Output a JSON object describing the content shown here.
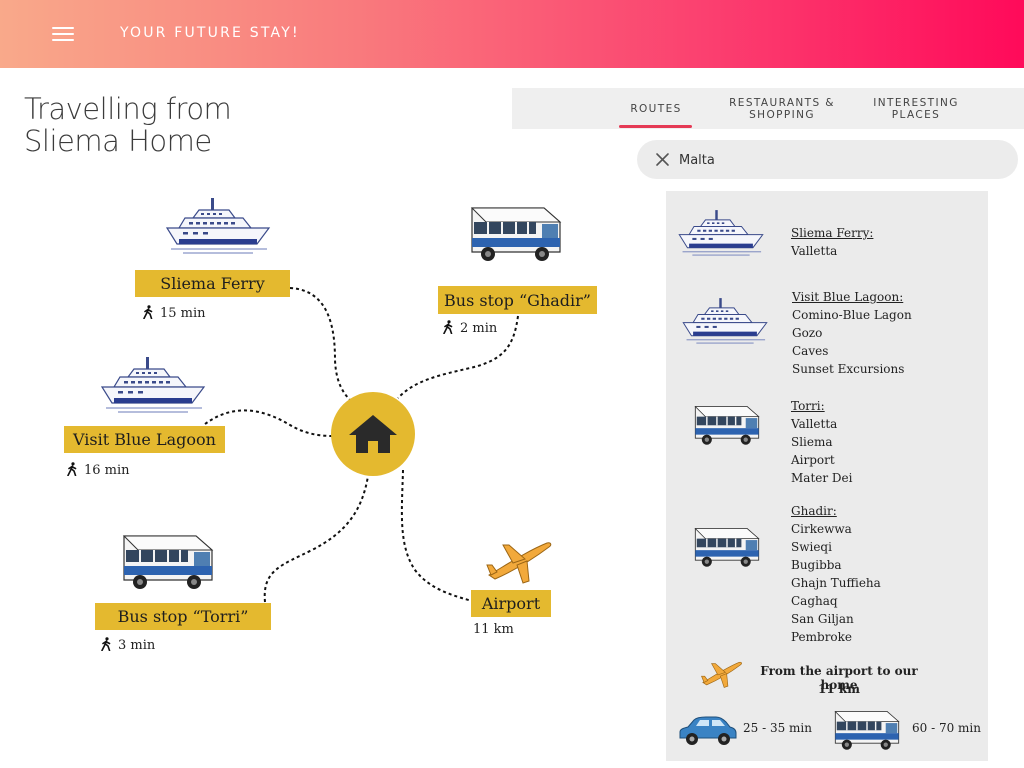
{
  "header": {
    "menu_icon": "hamburger-menu-icon",
    "brand": "YOUR FUTURE STAY!",
    "gradient": [
      "#f9a98a",
      "#ff0a5a"
    ]
  },
  "page": {
    "title_line1": "Travelling from",
    "title_line2": "Sliema Home"
  },
  "tabs": [
    {
      "label": "ROUTES",
      "active": true
    },
    {
      "label_line1": "RESTAURANTS &",
      "label_line2": "SHOPPING"
    },
    {
      "label_line1": "INTERESTING",
      "label_line2": "PLACES"
    }
  ],
  "search": {
    "value": "Malta",
    "clear_icon": "close-icon"
  },
  "map": {
    "center_icon": "home-icon",
    "accent": "#e4b92f",
    "places": [
      {
        "name": "Sliema Ferry",
        "icon": "ferry-icon",
        "distance": "15 min",
        "mode": "walk"
      },
      {
        "name": "Visit Blue Lagoon",
        "icon": "ferry-icon",
        "distance": "16 min",
        "mode": "walk"
      },
      {
        "name": "Bus stop “Torri”",
        "icon": "bus-icon",
        "distance": "3 min",
        "mode": "walk"
      },
      {
        "name": "Bus stop “Ghadir”",
        "icon": "bus-icon",
        "distance": "2 min",
        "mode": "walk"
      },
      {
        "name": "Airport",
        "icon": "airplane-icon",
        "distance": "11 km",
        "mode": ""
      }
    ]
  },
  "panel": {
    "ferry": {
      "title": "Sliema Ferry:",
      "items": [
        "Valletta"
      ]
    },
    "lagoon": {
      "title": "Visit Blue Lagoon:",
      "items": [
        "Comino-Blue Lagon",
        "Gozo",
        "Caves",
        "Sunset Excursions"
      ]
    },
    "torri": {
      "title": "Torri:",
      "items": [
        "Valletta",
        "Sliema",
        "Airport",
        "Mater Dei"
      ]
    },
    "ghadir": {
      "title": "Ghadir:",
      "items": [
        "Cirkewwa",
        "Swieqi",
        "Bugibba",
        "Ghajn Tuffieha",
        "Caghaq",
        "San Giljan",
        "Pembroke"
      ]
    },
    "airport": {
      "line1": "From the airport to our home",
      "line2": "11 km"
    },
    "car_time": "25 - 35 min",
    "bus_time": "60 - 70 min"
  }
}
